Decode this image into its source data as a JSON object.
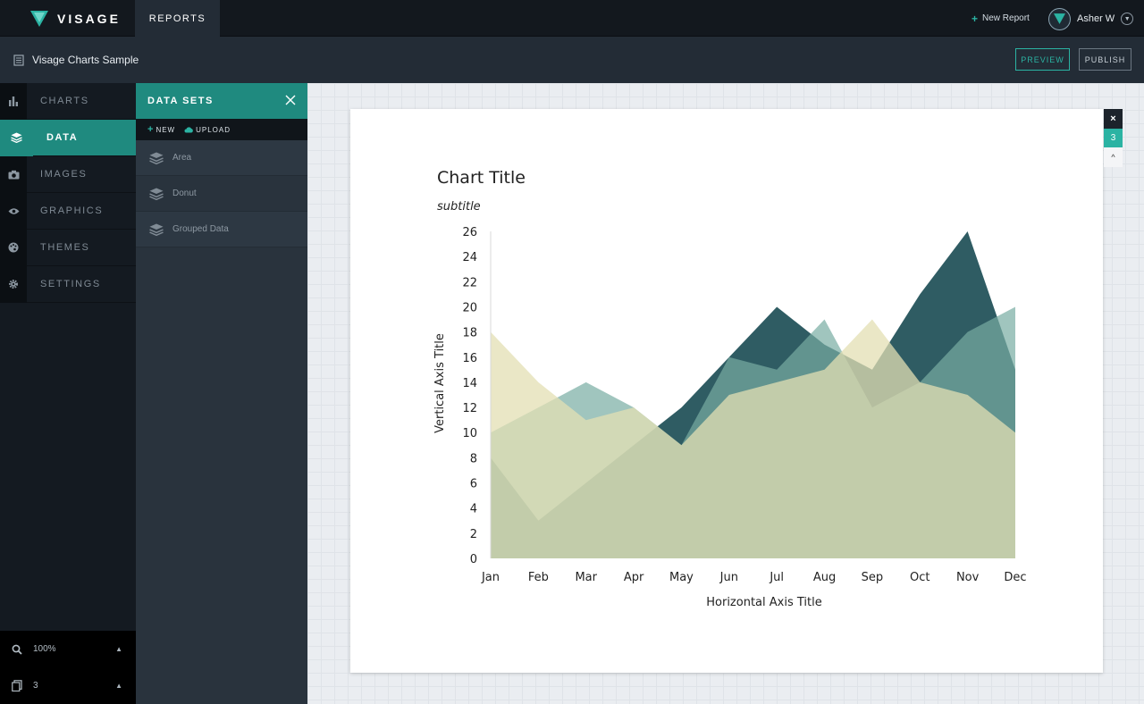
{
  "topbar": {
    "brand": "VISAGE",
    "tab": "REPORTS",
    "new_report": "New Report",
    "user_name": "Asher W"
  },
  "subbar": {
    "doc_title": "Visage Charts Sample",
    "preview": "PREVIEW",
    "publish": "PUBLISH"
  },
  "leftnav": {
    "items": [
      {
        "label": "CHARTS",
        "icon": "bar-chart-icon"
      },
      {
        "label": "DATA",
        "icon": "layers-icon",
        "active": true
      },
      {
        "label": "IMAGES",
        "icon": "camera-icon"
      },
      {
        "label": "GRAPHICS",
        "icon": "eye-icon"
      },
      {
        "label": "THEMES",
        "icon": "palette-icon"
      },
      {
        "label": "SETTINGS",
        "icon": "gear-icon"
      }
    ],
    "zoom": "100%",
    "pages": "3"
  },
  "datasets": {
    "title": "DATA SETS",
    "new_label": "NEW",
    "upload_label": "UPLOAD",
    "items": [
      "Area",
      "Donut",
      "Grouped Data"
    ]
  },
  "page_tools": {
    "close": "×",
    "page_number": "3",
    "up": "^"
  },
  "colors": {
    "accent": "#2bb3a3",
    "active_nav": "#1f8a7f"
  },
  "chart_data": {
    "type": "area",
    "title": "Chart Title",
    "subtitle": "subtitle",
    "xlabel": "Horizontal Axis Title",
    "ylabel": "Vertical Axis Title",
    "categories": [
      "Jan",
      "Feb",
      "Mar",
      "Apr",
      "May",
      "Jun",
      "Jul",
      "Aug",
      "Sep",
      "Oct",
      "Nov",
      "Dec"
    ],
    "yticks": [
      0,
      2,
      4,
      6,
      8,
      10,
      12,
      14,
      16,
      18,
      20,
      22,
      24,
      26
    ],
    "ylim": [
      0,
      26
    ],
    "grid": false,
    "series": [
      {
        "color": "#2f5c63",
        "opacity": 1.0,
        "values": [
          8,
          3,
          6,
          9,
          12,
          16,
          20,
          17,
          15,
          21,
          26,
          15
        ]
      },
      {
        "color": "#78aca3",
        "opacity": 0.7,
        "values": [
          10,
          12,
          14,
          12,
          9,
          16,
          15,
          19,
          12,
          14,
          18,
          20
        ]
      },
      {
        "color": "#e3dfb3",
        "opacity": 0.75,
        "values": [
          18,
          14,
          11,
          12,
          9,
          13,
          14,
          15,
          19,
          14,
          13,
          10
        ]
      }
    ]
  }
}
